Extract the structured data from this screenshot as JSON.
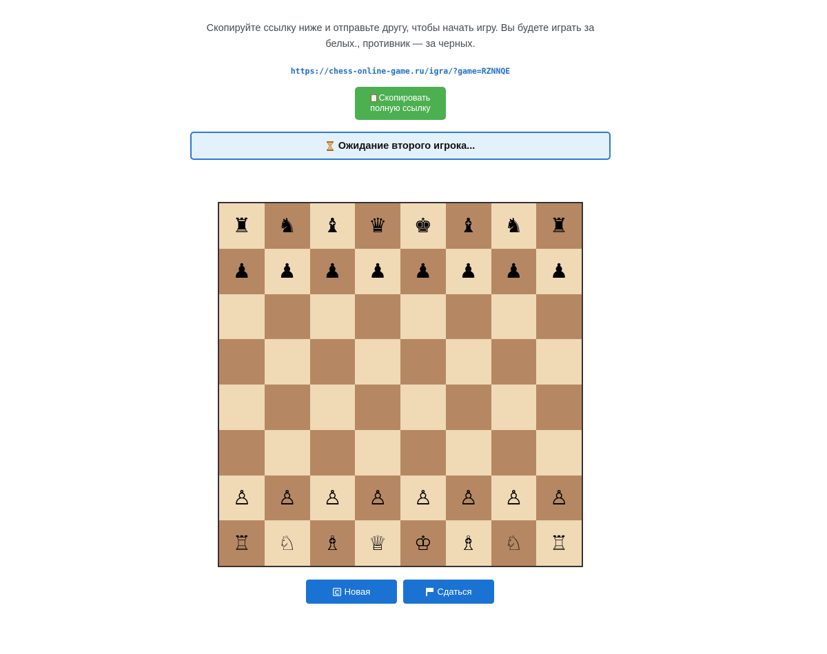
{
  "intro": {
    "instructions": "Скопируйте ссылку ниже и отправьте другу, чтобы начать игру. Вы будете играть за белых., противник — за черных.",
    "link": "https://chess-online-game.ru/igra/?game=RZNNQE",
    "copy_button_line1": "Скопировать",
    "copy_button_line2": "полную ссылку"
  },
  "status": {
    "text": "Ожидание второго игрока..."
  },
  "board": {
    "light_color": "#f0d9b5",
    "dark_color": "#b58863",
    "rows": [
      [
        "♜",
        "♞",
        "♝",
        "♛",
        "♚",
        "♝",
        "♞",
        "♜"
      ],
      [
        "♟",
        "♟",
        "♟",
        "♟",
        "♟",
        "♟",
        "♟",
        "♟"
      ],
      [
        "",
        "",
        "",
        "",
        "",
        "",
        "",
        ""
      ],
      [
        "",
        "",
        "",
        "",
        "",
        "",
        "",
        ""
      ],
      [
        "",
        "",
        "",
        "",
        "",
        "",
        "",
        ""
      ],
      [
        "",
        "",
        "",
        "",
        "",
        "",
        "",
        ""
      ],
      [
        "♙",
        "♙",
        "♙",
        "♙",
        "♙",
        "♙",
        "♙",
        "♙"
      ],
      [
        "♖",
        "♘",
        "♗",
        "♕",
        "♔",
        "♗",
        "♘",
        "♖"
      ]
    ]
  },
  "actions": {
    "new_label": "Новая",
    "resign_label": "Сдаться",
    "accent_color": "#1a73d2",
    "copy_color": "#4caf50"
  }
}
